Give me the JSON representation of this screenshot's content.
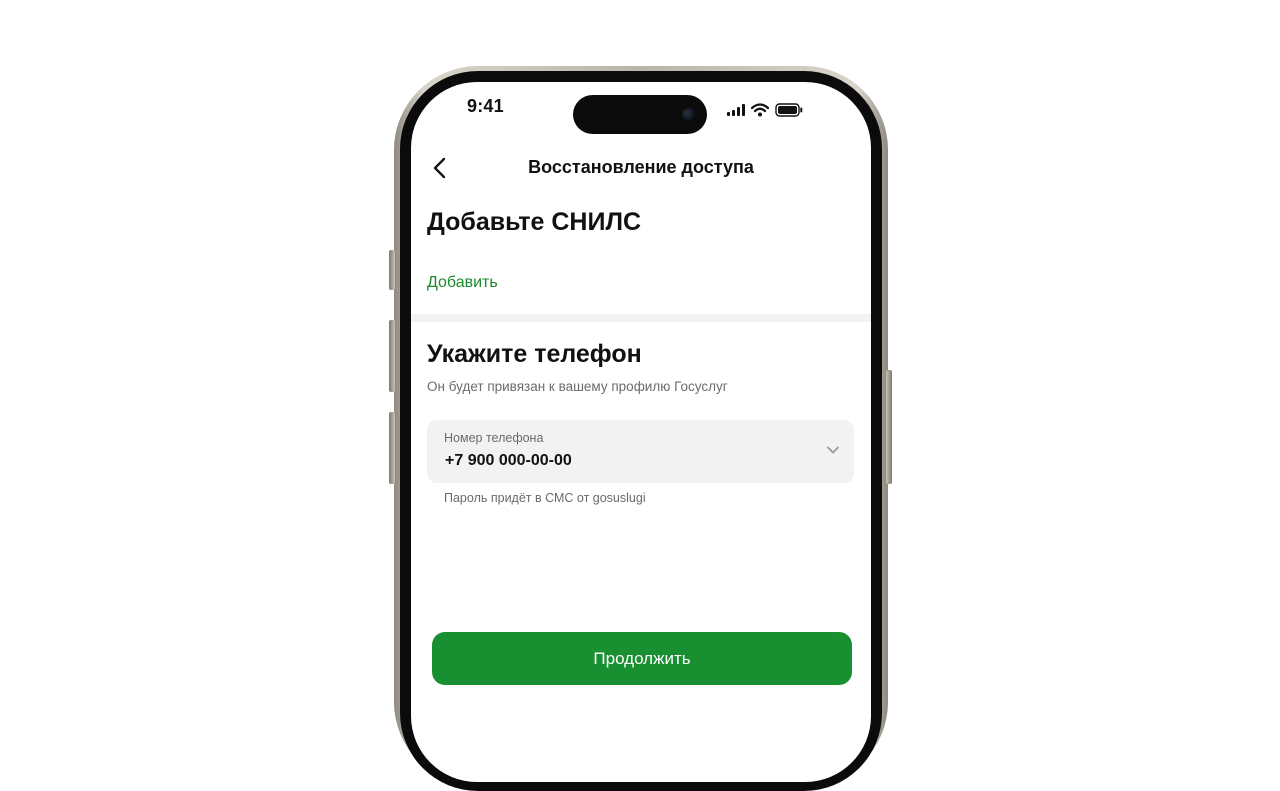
{
  "status_bar": {
    "time": "9:41",
    "icons": [
      "cellular-signal-icon",
      "wifi-icon",
      "battery-icon"
    ]
  },
  "nav": {
    "back_icon": "chevron-left-icon",
    "title": "Восстановление доступа"
  },
  "snils_section": {
    "title": "Добавьте СНИЛС",
    "add_label": "Добавить"
  },
  "phone_section": {
    "title": "Укажите телефон",
    "subtitle": "Он будет привязан к вашему профилю Госуслуг",
    "field": {
      "label": "Номер телефона",
      "value": "+7 900 000-00-00",
      "icon": "chevron-down-icon"
    },
    "hint": "Пароль придёт в СМС от gosuslugi"
  },
  "actions": {
    "continue_label": "Продолжить"
  },
  "colors": {
    "accent_green": "#188f30",
    "link_green": "#1a8a2e",
    "field_bg": "#f2f2f2",
    "muted_text": "#6b6b6b"
  }
}
